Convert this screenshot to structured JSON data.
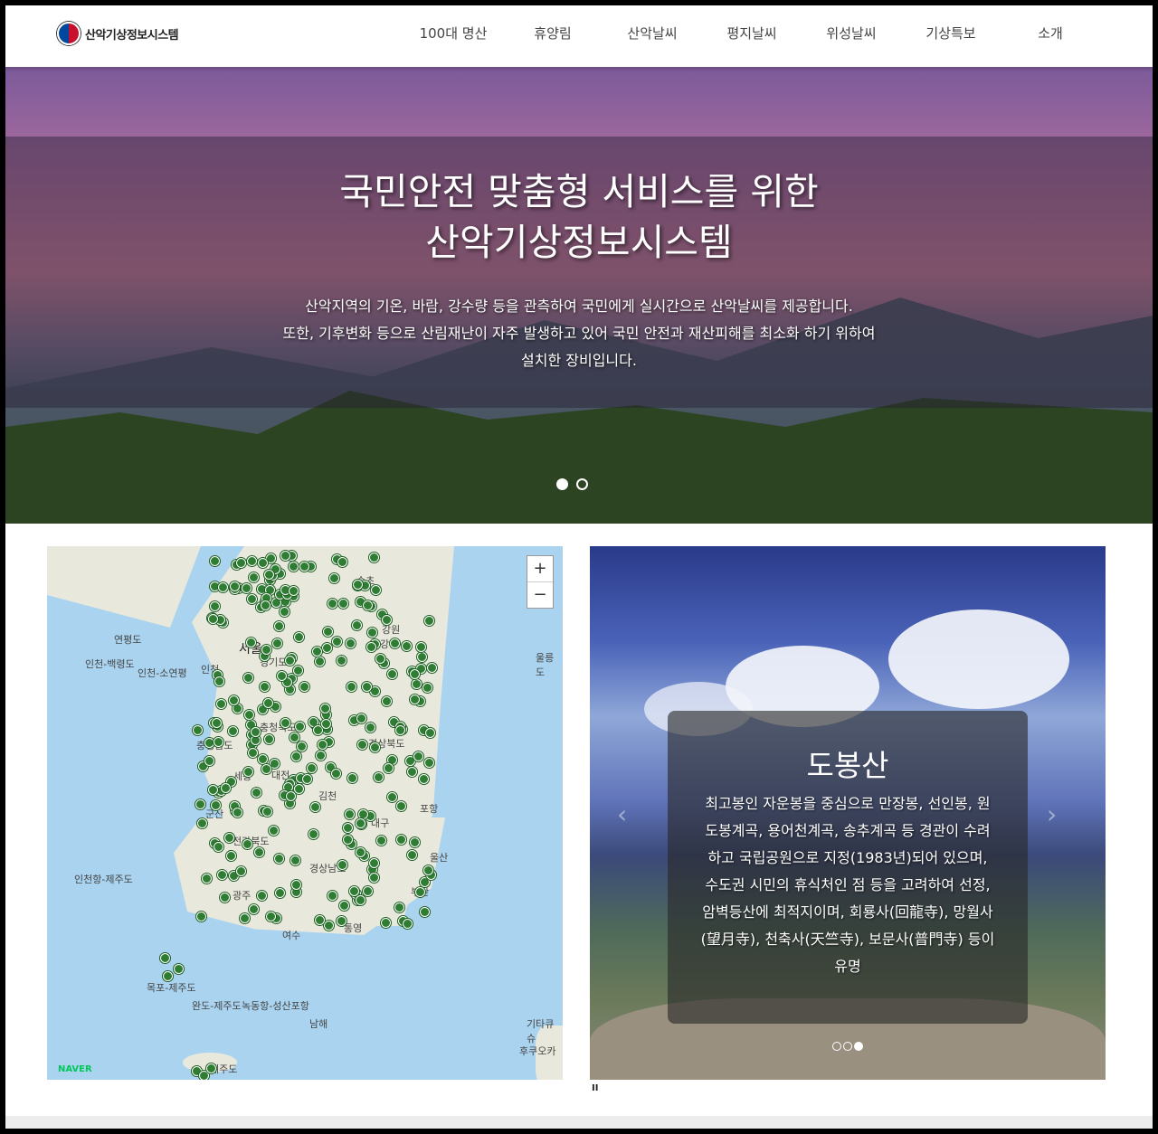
{
  "header": {
    "logo_text": "산악기상정보시스템",
    "nav": [
      "100대 명산",
      "휴양림",
      "산악날씨",
      "평지날씨",
      "위성날씨",
      "기상특보",
      "소개"
    ]
  },
  "hero": {
    "title_line1": "국민안전 맞춤형 서비스를 위한",
    "title_line2": "산악기상정보시스템",
    "desc_line1": "산악지역의 기온, 바람, 강수량 등을 관측하여 국민에게 실시간으로 산악날씨를 제공합니다.",
    "desc_line2": "또한, 기후변화 등으로 산림재난이 자주 발생하고 있어 국민 안전과 재산피해를 최소화 하기 위하여",
    "desc_line3": "설치한 장비입니다.",
    "active_slide": 1,
    "slide_count": 2
  },
  "map": {
    "zoom_in": "+",
    "zoom_out": "−",
    "brand": "NAVER",
    "labels": [
      "서울",
      "인천",
      "경기도",
      "강원",
      "속초",
      "강릉",
      "연평도",
      "울릉도",
      "인천-백령도",
      "인천-소연평",
      "충청북도",
      "충청남도",
      "세종",
      "대전",
      "경상북도",
      "김천",
      "군산",
      "포항",
      "대구",
      "전라북도",
      "울산",
      "경상남도",
      "광주",
      "부산",
      "통영",
      "여수",
      "남해",
      "기타큐슈",
      "후쿠오카",
      "제주도",
      "인천항-제주도",
      "목포-제주도",
      "완도-제주도",
      "녹동항-성산포항"
    ]
  },
  "mountain_slider": {
    "title": "도봉산",
    "desc": "최고봉인 자운봉을 중심으로 만장봉, 선인봉, 원도봉계곡, 용어천계곡, 송추계곡 등 경관이 수려하고 국립공원으로 지정(1983년)되어 있으며, 수도권 시민의 휴식처인 점 등을 고려하여 선정, 암벽등산에 최적지이며, 회룡사(回龍寺), 망월사(望月寺), 천축사(天竺寺), 보문사(普門寺) 등이 유명",
    "prev": "‹",
    "next": "›",
    "active_slide": 3,
    "slide_count": 3,
    "pause": "II"
  }
}
